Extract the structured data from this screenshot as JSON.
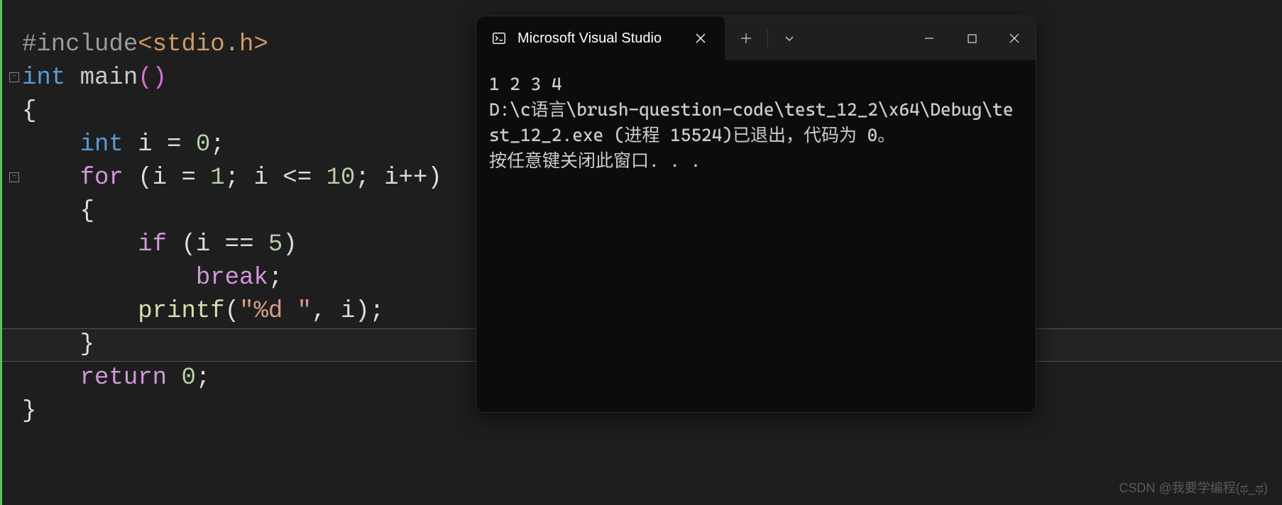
{
  "code": {
    "line1_include": "#include",
    "line1_header": "<stdio.h>",
    "line2_type": "int",
    "line2_func": " main",
    "line2_parens": "()",
    "line3_brace": "{",
    "line4_indent": "    ",
    "line4_type": "int",
    "line4_rest": " i = ",
    "line4_num": "0",
    "line4_semi": ";",
    "line5_indent": "    ",
    "line5_for": "for",
    "line5_open": " (i = ",
    "line5_n1": "1",
    "line5_mid": "; i <= ",
    "line5_n2": "10",
    "line5_end": "; i++)",
    "line6_indent": "    ",
    "line6_brace": "{",
    "line7_indent": "        ",
    "line7_if": "if",
    "line7_open": " (i == ",
    "line7_num": "5",
    "line7_close": ")",
    "line8_indent": "            ",
    "line8_break": "break",
    "line8_semi": ";",
    "line9_indent": "        ",
    "line9_printf": "printf",
    "line9_open": "(",
    "line9_str": "\"%d \"",
    "line9_close": ", i);",
    "line10_indent": "    ",
    "line10_brace": "}",
    "line11_indent": "    ",
    "line11_return": "return",
    "line11_sp": " ",
    "line11_num": "0",
    "line11_semi": ";",
    "line12_brace": "}"
  },
  "console": {
    "tab_title": "Microsoft Visual Studio",
    "output_line1": "1 2 3 4",
    "output_line2": "D:\\c语言\\brush-question-code\\test_12_2\\x64\\Debug\\test_12_2.exe (进程 15524)已退出，代码为 0。",
    "output_line3": "按任意键关闭此窗口. . ."
  },
  "watermark": "CSDN @我要学编程(ಥ_ಥ)"
}
